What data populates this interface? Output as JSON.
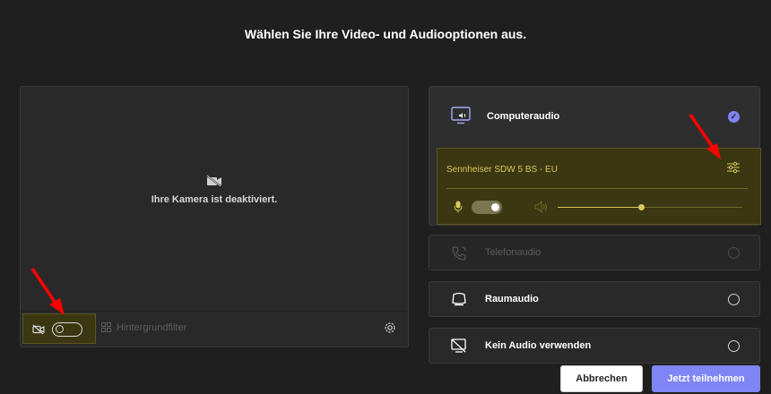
{
  "header": {
    "title": "Wählen Sie Ihre Video- und Audiooptionen aus."
  },
  "video": {
    "camera_status": "Ihre Kamera ist deaktiviert.",
    "camera_toggle_on": false,
    "background_filter_label": "Hintergrundfilter"
  },
  "audio": {
    "computer": {
      "label": "Computeraudio",
      "selected": true,
      "device_name": "Sennheiser SDW 5 BS - EU",
      "mic_on": true,
      "volume": 0.45
    },
    "options": [
      {
        "label": "Telefonaudio",
        "enabled": false
      },
      {
        "label": "Raumaudio",
        "enabled": true
      },
      {
        "label": "Kein Audio verwenden",
        "enabled": true
      }
    ]
  },
  "buttons": {
    "cancel": "Abbrechen",
    "join": "Jetzt teilnehmen"
  },
  "colors": {
    "background": "#1f1f1f",
    "panel": "#292929",
    "accent": "#7f85f5",
    "highlight_fill": "#3a3712",
    "highlight_text": "#d9c95a",
    "annotation_arrow": "#ff0000"
  },
  "icons": {
    "computer_audio": "monitor-speaker-icon",
    "phone_audio": "phone-icon",
    "room_audio": "room-device-icon",
    "no_audio": "no-audio-icon",
    "camera_off": "camera-off-icon",
    "settings": "gear-icon",
    "device_settings": "sliders-icon"
  }
}
